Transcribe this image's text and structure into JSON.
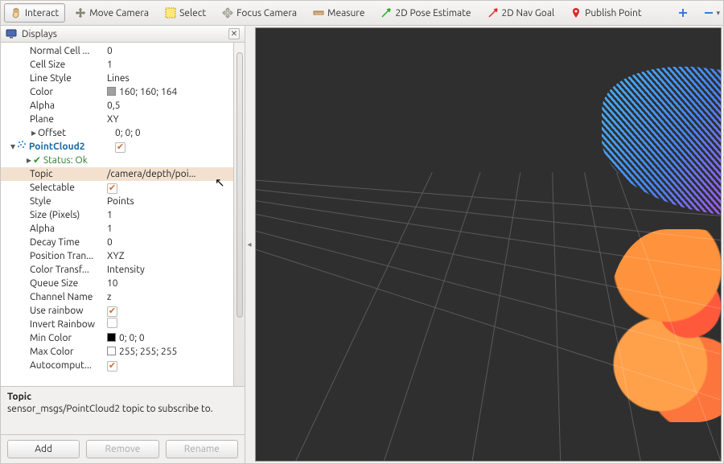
{
  "toolbar": {
    "interact": "Interact",
    "move_camera": "Move Camera",
    "select": "Select",
    "focus_camera": "Focus Camera",
    "measure": "Measure",
    "pose_2d": "2D Pose Estimate",
    "nav_2d": "2D Nav Goal",
    "publish_point": "Publish Point"
  },
  "panel": {
    "title": "Displays",
    "selected_label": "Topic",
    "rows": [
      {
        "label": "Normal Cell ...",
        "value": "0",
        "indent": 36
      },
      {
        "label": "Cell Size",
        "value": "1",
        "indent": 36
      },
      {
        "label": "Line Style",
        "value": "Lines",
        "indent": 36
      },
      {
        "label": "Color",
        "value": "160; 160; 164",
        "indent": 36,
        "swatch": "#a0a0a4"
      },
      {
        "label": "Alpha",
        "value": "0,5",
        "indent": 36
      },
      {
        "label": "Plane",
        "value": "XY",
        "indent": 36
      },
      {
        "label": "Offset",
        "value": "0; 0; 0",
        "indent": 36,
        "expander": "▸"
      },
      {
        "label": "PointCloud2",
        "value": "",
        "indent": 10,
        "expander": "▾",
        "pc2": true,
        "check": true
      },
      {
        "label": "Status: Ok",
        "value": "",
        "indent": 30,
        "expander": "▸",
        "status": true
      },
      {
        "label": "Topic",
        "value": "/camera/depth/poi...",
        "indent": 36,
        "selected": true
      },
      {
        "label": "Selectable",
        "value": "",
        "indent": 36,
        "check": true
      },
      {
        "label": "Style",
        "value": "Points",
        "indent": 36
      },
      {
        "label": "Size (Pixels)",
        "value": "1",
        "indent": 36
      },
      {
        "label": "Alpha",
        "value": "1",
        "indent": 36
      },
      {
        "label": "Decay Time",
        "value": "0",
        "indent": 36
      },
      {
        "label": "Position Tran...",
        "value": "XYZ",
        "indent": 36
      },
      {
        "label": "Color Transf...",
        "value": "Intensity",
        "indent": 36
      },
      {
        "label": "Queue Size",
        "value": "10",
        "indent": 36
      },
      {
        "label": "Channel Name",
        "value": "z",
        "indent": 36
      },
      {
        "label": "Use rainbow",
        "value": "",
        "indent": 36,
        "check": true
      },
      {
        "label": "Invert Rainbow",
        "value": "",
        "indent": 36,
        "check": false
      },
      {
        "label": "Min Color",
        "value": "0; 0; 0",
        "indent": 36,
        "swatch": "#000000"
      },
      {
        "label": "Max Color",
        "value": "255; 255; 255",
        "indent": 36,
        "swatch": "#ffffff"
      },
      {
        "label": "Autocomput...",
        "value": "",
        "indent": 36,
        "check": true
      }
    ]
  },
  "description": {
    "title": "Topic",
    "body": "sensor_msgs/PointCloud2 topic to subscribe to."
  },
  "buttons": {
    "add": "Add",
    "remove": "Remove",
    "rename": "Rename"
  }
}
